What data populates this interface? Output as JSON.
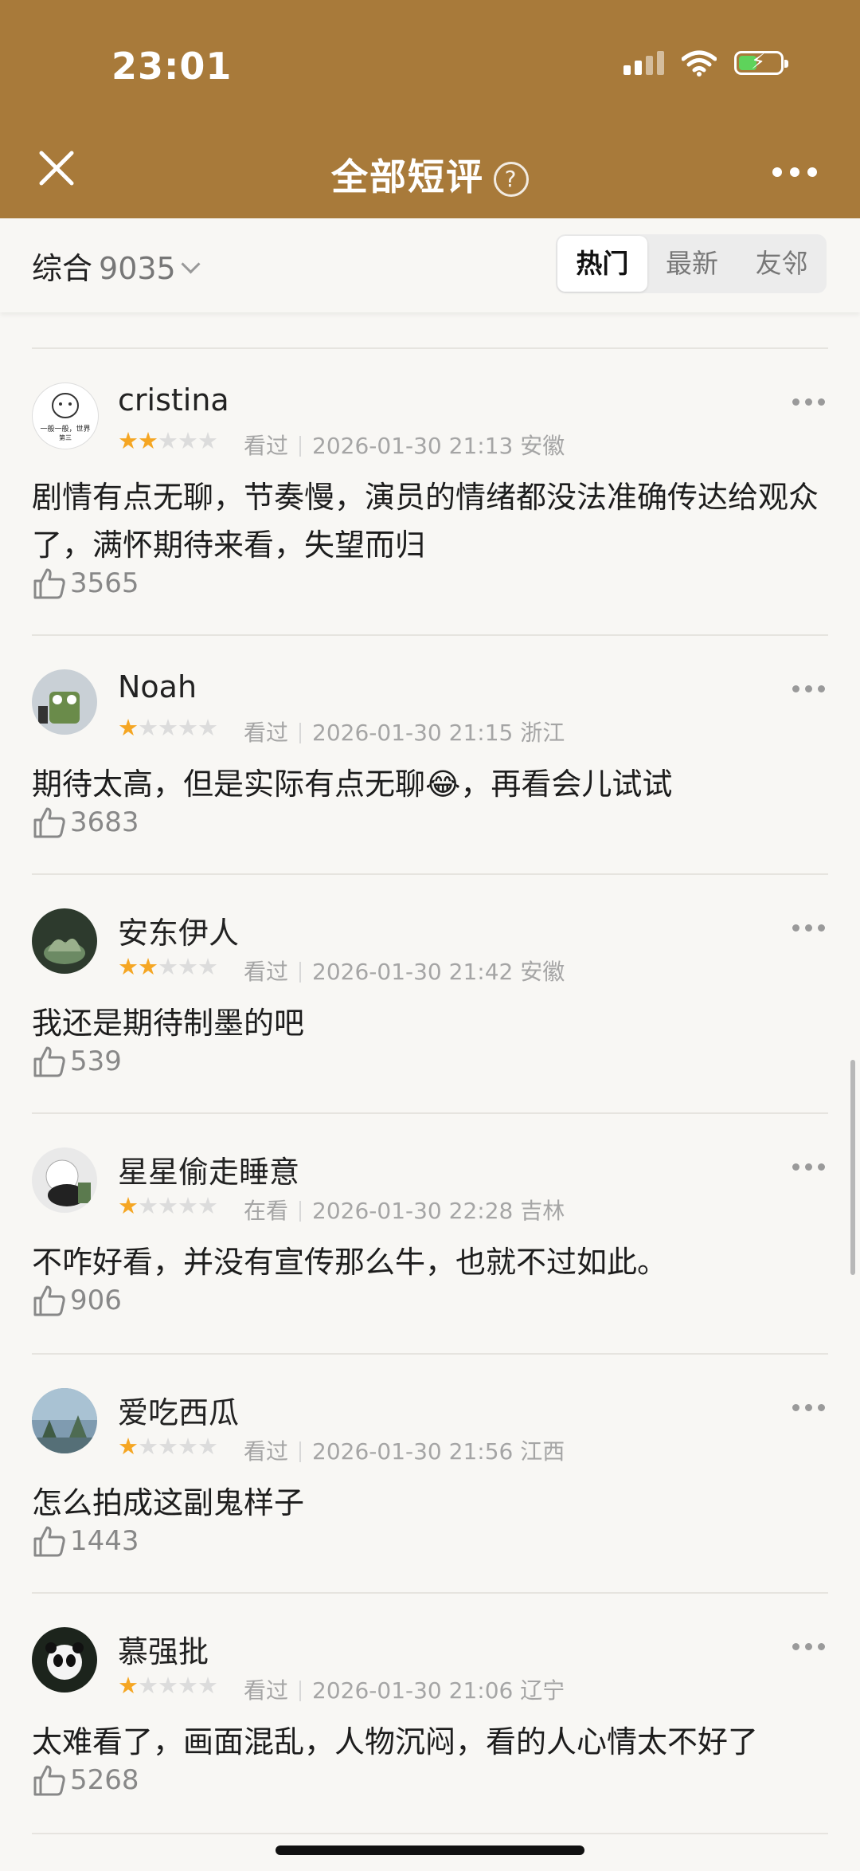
{
  "status_bar": {
    "time": "23:01"
  },
  "nav": {
    "title": "全部短评",
    "help_glyph": "?"
  },
  "subbar": {
    "sort_label": "综合",
    "count": "9035",
    "tabs": [
      {
        "label": "热门",
        "active": true
      },
      {
        "label": "最新",
        "active": false
      },
      {
        "label": "友邻",
        "active": false
      }
    ]
  },
  "reviews": [
    {
      "user": "cristina",
      "rating": 2,
      "status": "看过",
      "datetime": "2026-01-30 21:13",
      "region": "安徽",
      "text": "剧情有点无聊，节奏慢，演员的情绪都没法准确传达给观众了，满怀期待来看，失望而归",
      "likes": "3565",
      "avatar_text": [
        "一般一般，世界",
        "第三"
      ]
    },
    {
      "user": "Noah",
      "rating": 1,
      "status": "看过",
      "datetime": "2026-01-30 21:15",
      "region": "浙江",
      "text": "期待太高，但是实际有点无聊😂，再看会儿试试",
      "likes": "3683"
    },
    {
      "user": "安东伊人",
      "rating": 2,
      "status": "看过",
      "datetime": "2026-01-30 21:42",
      "region": "安徽",
      "text": "我还是期待制墨的吧",
      "likes": "539"
    },
    {
      "user": "星星偷走睡意",
      "rating": 1,
      "status": "在看",
      "datetime": "2026-01-30 22:28",
      "region": "吉林",
      "text": "不咋好看，并没有宣传那么牛，也就不过如此。",
      "likes": "906"
    },
    {
      "user": "爱吃西瓜",
      "rating": 1,
      "status": "看过",
      "datetime": "2026-01-30 21:56",
      "region": "江西",
      "text": "怎么拍成这副鬼样子",
      "likes": "1443"
    },
    {
      "user": "慕强批",
      "rating": 1,
      "status": "看过",
      "datetime": "2026-01-30 21:06",
      "region": "辽宁",
      "text": "太难看了，画面混乱，人物沉闷，看的人心情太不好了",
      "likes": "5268"
    }
  ],
  "colors": {
    "header": "#a87a3a",
    "star_on": "#f5a623",
    "star_off": "#dcdcdc",
    "battery": "#5ed35b"
  }
}
